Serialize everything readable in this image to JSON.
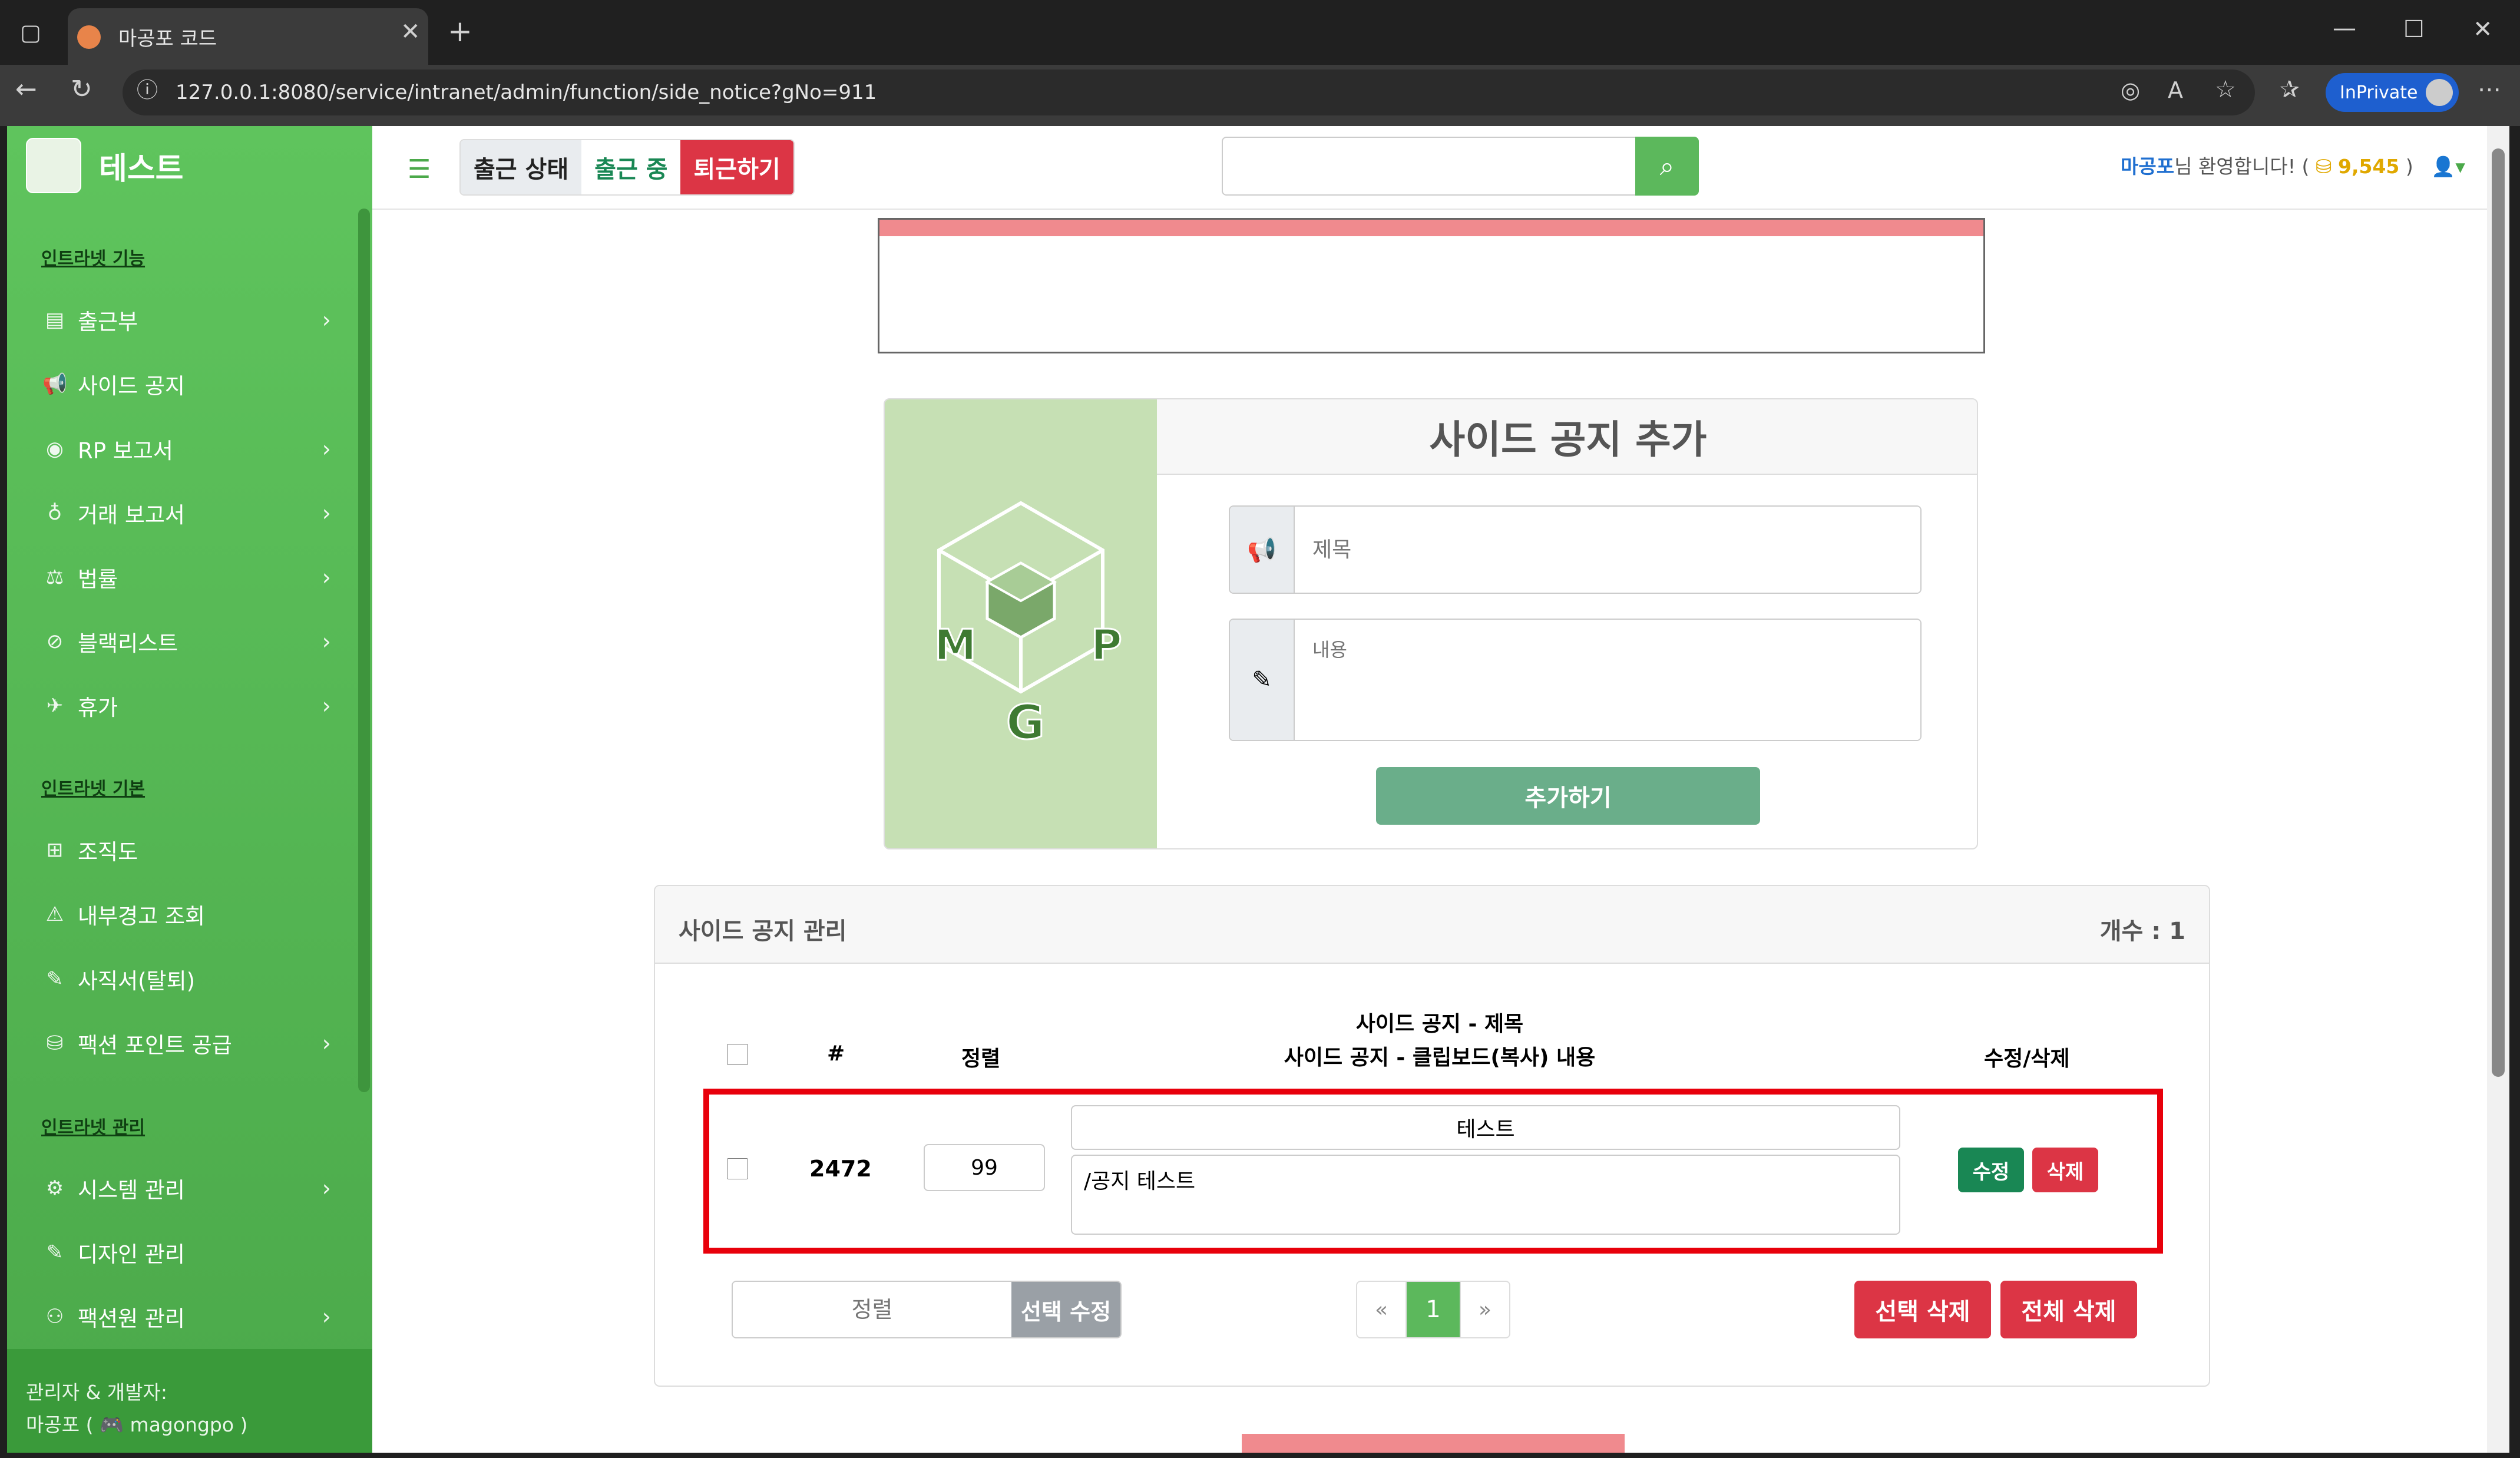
{
  "browser": {
    "tab_title": "마공포 코드",
    "url": "127.0.0.1:8080/service/intranet/admin/function/side_notice?gNo=911",
    "inprivate_label": "InPrivate"
  },
  "sidebar": {
    "brand": "테스트",
    "sections": [
      {
        "title": "인트라넷 기능",
        "items": [
          {
            "label": "출근부",
            "icon": "book-icon",
            "chevron": true
          },
          {
            "label": "사이드 공지",
            "icon": "megaphone-icon",
            "chevron": false
          },
          {
            "label": "RP 보고서",
            "icon": "gamepad-icon",
            "chevron": true
          },
          {
            "label": "거래 보고서",
            "icon": "money-bag-icon",
            "chevron": true
          },
          {
            "label": "법률",
            "icon": "scale-icon",
            "chevron": true
          },
          {
            "label": "블랙리스트",
            "icon": "ban-icon",
            "chevron": true
          },
          {
            "label": "휴가",
            "icon": "plane-icon",
            "chevron": true
          }
        ]
      },
      {
        "title": "인트라넷 기본",
        "items": [
          {
            "label": "조직도",
            "icon": "sitemap-icon",
            "chevron": false
          },
          {
            "label": "내부경고 조회",
            "icon": "warning-icon",
            "chevron": false
          },
          {
            "label": "사직서(탈퇴)",
            "icon": "pen-icon",
            "chevron": false
          },
          {
            "label": "팩션 포인트 공급",
            "icon": "coins-icon",
            "chevron": true
          }
        ]
      },
      {
        "title": "인트라넷 관리",
        "items": [
          {
            "label": "시스템 관리",
            "icon": "gear-icon",
            "chevron": true
          },
          {
            "label": "디자인 관리",
            "icon": "brush-icon",
            "chevron": false
          },
          {
            "label": "팩션원 관리",
            "icon": "users-gear-icon",
            "chevron": true
          }
        ]
      }
    ],
    "footer_line1": "관리자 & 개발자:",
    "footer_name": "마공포 (",
    "footer_handle": "magongpo )"
  },
  "topbar": {
    "status_label": "출근 상태",
    "status_value": "출근 중",
    "leave_button": "퇴근하기",
    "search_placeholder": "",
    "welcome_name": "마공포",
    "welcome_text": "님 환영합니다! (",
    "points": "9,545",
    "points_close": ")"
  },
  "add_form": {
    "title": "사이드 공지 추가",
    "title_placeholder": "제목",
    "content_placeholder": "내용",
    "submit": "추가하기",
    "logo_letters": [
      "M",
      "G",
      "P"
    ]
  },
  "manage": {
    "title": "사이드 공지 관리",
    "count_label": "개수 : 1",
    "col_num": "#",
    "col_sort": "정렬",
    "col_title_line1": "사이드 공지 - 제목",
    "col_title_line2": "사이드 공지 - 클립보드(복사) 내용",
    "col_actions": "수정/삭제",
    "rows": [
      {
        "id": "2472",
        "sort": "99",
        "title": "테스트",
        "content": "/공지 테스트",
        "edit": "수정",
        "delete": "삭제"
      }
    ],
    "sort_placeholder": "정렬",
    "bulk_edit": "선택 수정",
    "pagination": {
      "prev": "«",
      "current": "1",
      "next": "»"
    },
    "delete_selected": "선택 삭제",
    "delete_all": "전체 삭제"
  },
  "colors": {
    "brand_green": "#5cb85c",
    "danger": "#dc3545",
    "success": "#198754",
    "highlight": "#e8000b"
  }
}
